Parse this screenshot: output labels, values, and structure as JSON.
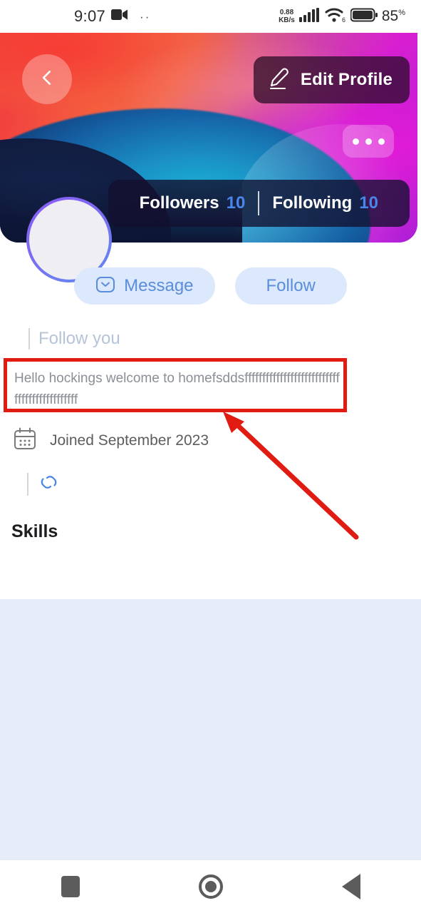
{
  "status_bar": {
    "time": "9:07",
    "video_icon": "video-camera-icon",
    "dots": "··",
    "network_speed_value": "0.88",
    "network_speed_unit": "KB/s",
    "signal_icon": "signal-bars-icon",
    "wifi_icon": "wifi-6-icon",
    "battery_icon": "battery-icon",
    "battery_percent": "85",
    "battery_percent_symbol": "%"
  },
  "banner": {
    "back_icon": "chevron-left-icon",
    "edit_profile_label": "Edit Profile",
    "edit_profile_icon": "pencil-edit-icon",
    "more_icon": "more-horizontal-icon",
    "stats": {
      "followers_label": "Followers",
      "followers_count": "10",
      "following_label": "Following",
      "following_count": "10"
    }
  },
  "profile": {
    "avatar": "empty-avatar-placeholder",
    "message_button_label": "Message",
    "message_icon": "message-envelope-icon",
    "follow_button_label": "Follow",
    "follow_you_label": "Follow you",
    "bio": "Hello hockings welcome to homefsddsfffffffffffffffffffffffffffffffffffffffffffff",
    "joined_label": "Joined September 2023",
    "calendar_icon": "calendar-icon",
    "link_icon": "link-chain-icon",
    "skills_heading": "Skills"
  },
  "nav_bar": {
    "recents_icon": "square-recents-icon",
    "home_icon": "circle-home-icon",
    "back_icon": "triangle-back-icon"
  },
  "annotations": {
    "highlight_color": "#e01b12",
    "highlight_target": "bio-text",
    "arrow_color": "#e01b12"
  },
  "colors": {
    "accent_blue": "#4a86e8",
    "pill_blue_bg": "#dce8fb",
    "pill_blue_text": "#5a8ddb",
    "section_blue_bg": "#e5ecf8",
    "avatar_ring_from": "#8b5cf6",
    "avatar_ring_to": "#5f8df0"
  }
}
